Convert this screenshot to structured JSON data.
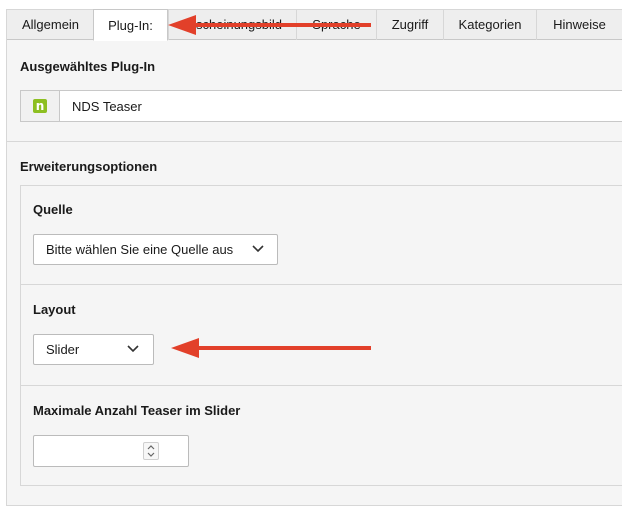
{
  "tabs": [
    {
      "label": "Allgemein",
      "active": false
    },
    {
      "label": "Plug-In:",
      "active": true
    },
    {
      "label": "Erscheinungsbild",
      "active": false
    },
    {
      "label": "Sprache",
      "active": false
    },
    {
      "label": "Zugriff",
      "active": false
    },
    {
      "label": "Kategorien",
      "active": false
    },
    {
      "label": "Hinweise",
      "active": false
    }
  ],
  "plugin_section": {
    "title": "Ausgewähltes Plug-In",
    "plugin_name": "NDS Teaser",
    "icon": "nds-plugin-icon",
    "icon_glyph": "n"
  },
  "extension_section": {
    "title": "Erweiterungsoptionen",
    "source": {
      "label": "Quelle",
      "selected": "Bitte wählen Sie eine Quelle aus"
    },
    "layout": {
      "label": "Layout",
      "selected": "Slider"
    },
    "max_teasers": {
      "label": "Maximale Anzahl Teaser im Slider",
      "value": ""
    }
  },
  "annotations": {
    "arrow_color": "#e2402a",
    "icon": "red-arrow-icon"
  },
  "colors": {
    "accent_green": "#8dbf21",
    "panel_bg": "#f5f5f5",
    "border": "#d7d7d7"
  }
}
